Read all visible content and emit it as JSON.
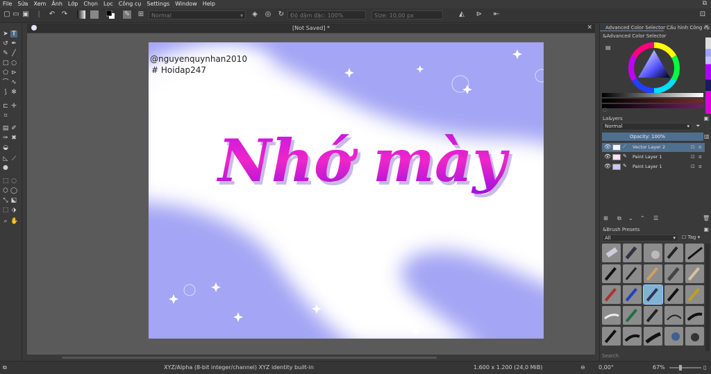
{
  "menubar": {
    "items": [
      "File",
      "Sửa",
      "Xem",
      "Ảnh",
      "Lớp",
      "Chọn",
      "Lọc",
      "Công cụ",
      "Settings",
      "Window",
      "Help"
    ],
    "restore_icon": "window-restore-icon"
  },
  "toolbar": {
    "blend_mode": "Normal",
    "opacity_label": "Độ đậm đặc: 100%",
    "size_label": "Size: 10,00 px"
  },
  "document": {
    "tab_title": "[Not Saved]  *",
    "canvas_text_1": "@nguyenquynhan2010",
    "canvas_text_2": "# Hoidap247",
    "canvas_title": "Nhớ mày"
  },
  "dock": {
    "tab_color_selector": "Advanced Color Selector",
    "tab_tool_options": "Cấu hình Công cụ",
    "color_selector_title": "&Advanced Color Selector",
    "layers_title": "La&yers",
    "layers_blend": "Normal",
    "layers_opacity": "Opacity:  100%",
    "layers": [
      {
        "name": "Vector Layer 2",
        "selected": true
      },
      {
        "name": "Paint Layer 1",
        "selected": false
      },
      {
        "name": "Paint Layer 1",
        "selected": false
      }
    ],
    "brush_presets_title": "&Brush Presets",
    "brush_filter": "All",
    "brush_tag": "Tag",
    "brush_search_placeholder": "Search"
  },
  "statusbar": {
    "color_space": "XYZ/Alpha (8-bit integer/channel)  XYZ identity built-in",
    "image_size": "1.600 x 1.200 (24,0 MiB)",
    "rotation": "0,00°",
    "zoom": "67%"
  },
  "colors": {
    "canvas_lavender": "#a3a4f3",
    "title_magenta": "#e21fd0",
    "selection_blue": "#4f6f8f"
  }
}
